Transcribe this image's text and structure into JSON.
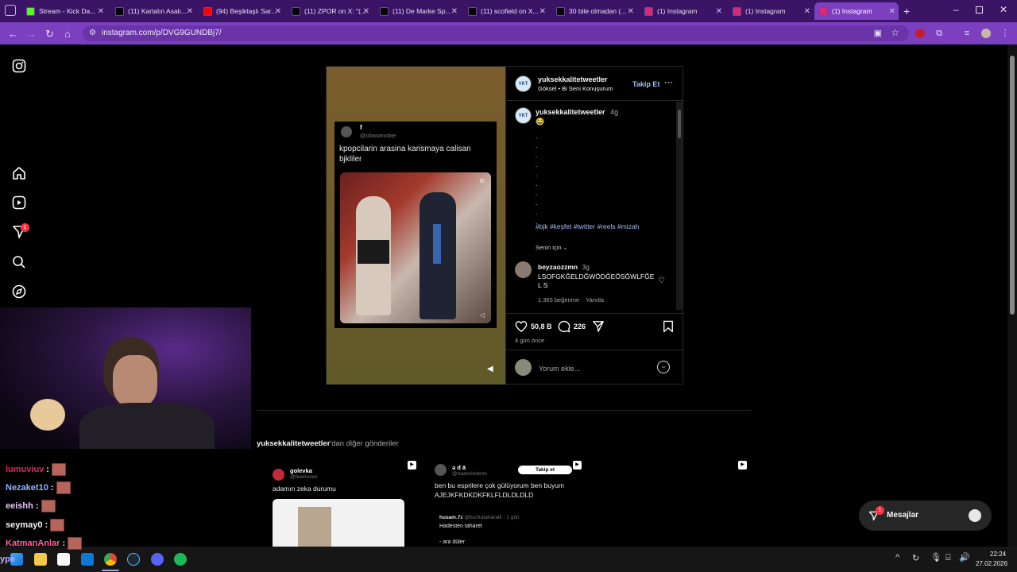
{
  "tabs": [
    {
      "title": "Stream - Kick Da...",
      "icon": "kick-icon",
      "color": "#53fc18"
    },
    {
      "title": "(11) Kartalın Asalı...",
      "icon": "x-icon",
      "color": "#000000"
    },
    {
      "title": "(94) Beşiktaşlı Sar...",
      "icon": "youtube-icon",
      "color": "#ff0000"
    },
    {
      "title": "(11) ZPOR on X: \"(...",
      "icon": "x-icon",
      "color": "#000000"
    },
    {
      "title": "(11) De Marke Sp...",
      "icon": "x-icon",
      "color": "#000000"
    },
    {
      "title": "(11) scofield on X...",
      "icon": "x-icon",
      "color": "#000000"
    },
    {
      "title": "30 bile olmadan (...",
      "icon": "tiktok-icon",
      "color": "#000000"
    },
    {
      "title": "(1) Instagram",
      "icon": "instagram-icon",
      "color": "#d62976"
    },
    {
      "title": "(1) Instagram",
      "icon": "instagram-icon",
      "color": "#d62976"
    },
    {
      "title": "(1) Instagram",
      "icon": "instagram-icon",
      "color": "#d62976"
    }
  ],
  "address": {
    "url": "instagram.com/p/DVG9GUNDBj7/"
  },
  "post": {
    "author": "yuksekkalitetweetler",
    "audio": "Göksel • Bi Seni Konuşurum",
    "follow_label": "Takip Et",
    "caption_author": "yuksekkalitetweetler",
    "caption_time": "4g",
    "caption_emoji": "😂",
    "caption_dots": [
      ".",
      ".",
      ".",
      ".",
      ".",
      ".",
      ".",
      ".",
      ".",
      "."
    ],
    "hashtags": "#bjk #keşfet #twitter #reels #mizah",
    "for_you": "Senin için",
    "comment": {
      "user": "beyzaozzmn",
      "time": "3g",
      "text": "LSOFGKĞELDĞWÖDĞEÖSĞWLFĞEL S",
      "likes": "1.365 beğenme",
      "reply": "Yanıtla"
    },
    "like_count": "50,8 B",
    "comment_count": "226",
    "posted": "4 gün önce",
    "comment_placeholder": "Yorum ekle..."
  },
  "tweet": {
    "name": "f",
    "handle": "@obiwanobie",
    "text": "kpopcilarin arasina karismaya calisan bjkliler"
  },
  "more": {
    "author": "yuksekkalitetweetler",
    "suffix": "'dan diğer gönderiler"
  },
  "cards": [
    {
      "name": "golevka",
      "handle": "@hewruewr",
      "text": "adamın zeka durumu"
    },
    {
      "name": "ə d ā",
      "handle": "@nazenindenn",
      "follow": "Takip et",
      "text": "ben bu esprilere çok gülüyorum ben buyum AJEJKFKDKDKFKLFLDLDLDLD",
      "reply_user": "husam.7z",
      "reply_handle": "@buzlubaharatli · 1 gün",
      "reply_text": "Hadesten taharet",
      "reply_more": "- ara düler"
    },
    {}
  ],
  "messages": {
    "label": "Mesajlar",
    "badge": "1"
  },
  "notif_badge": "1",
  "chat": [
    {
      "user": "lumuviuv",
      "color": "#e0245e"
    },
    {
      "user": "Nezaket10",
      "color": "#8fb3ff"
    },
    {
      "user": "eeishh",
      "color": "#e6c5ff"
    },
    {
      "user": "seymay0",
      "color": "#f0f0f0"
    },
    {
      "user": "KatmanAnlar",
      "color": "#ff5fa2"
    }
  ],
  "chat_sep": ":",
  "overlay_label": "ype",
  "clock": {
    "time": "22:24",
    "date": "27.02.2026"
  }
}
